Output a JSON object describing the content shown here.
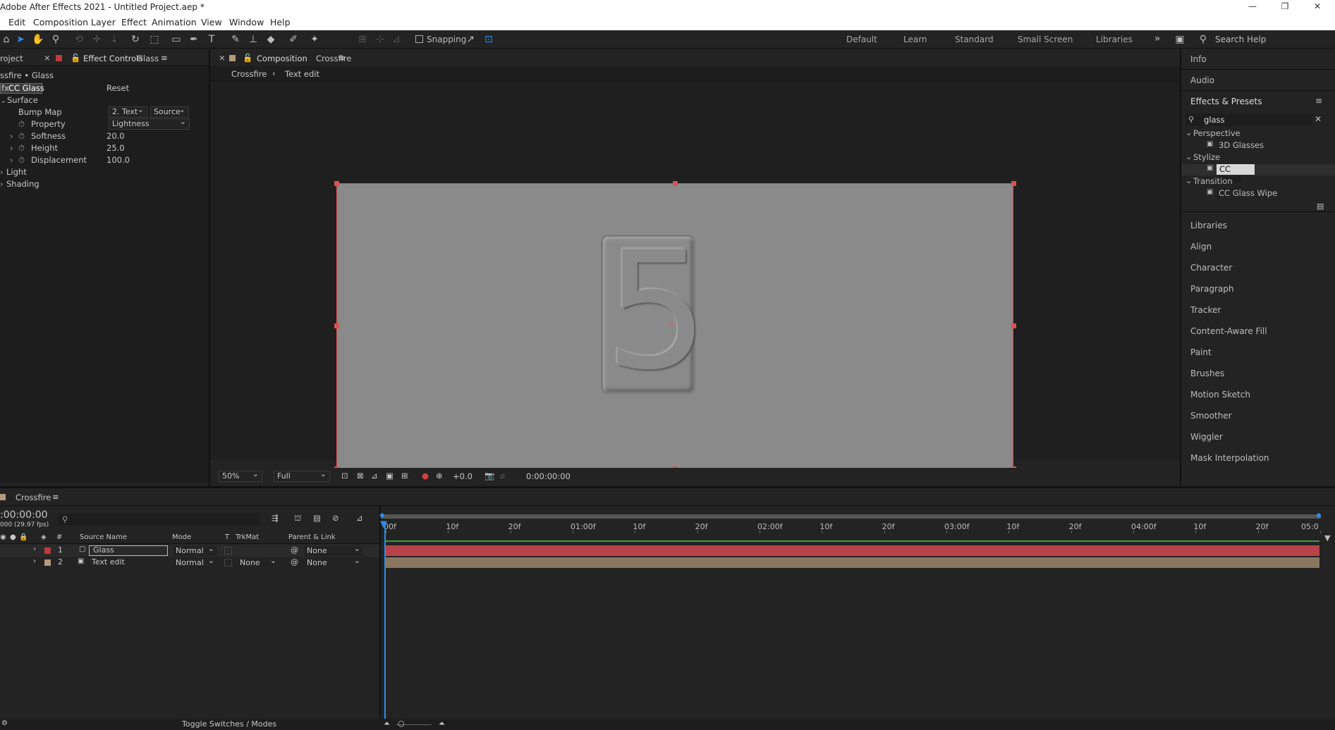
{
  "window": {
    "title": "Adobe After Effects 2021 - Untitled Project.aep *"
  },
  "menu": [
    "Edit",
    "Composition",
    "Layer",
    "Effect",
    "Animation",
    "View",
    "Window",
    "Help"
  ],
  "toolbar": {
    "snapping_label": "Snapping",
    "search_placeholder": "Search Help"
  },
  "workspaces": [
    "Default",
    "Learn",
    "Standard",
    "Small Screen",
    "Libraries"
  ],
  "effect_controls": {
    "project_tab": "roject",
    "tab_label": "Effect Controls",
    "tab_layer": "Glass",
    "breadcrumb": "ssfire • Glass",
    "effect_name": "CC Glass",
    "reset_label": "Reset",
    "surface_label": "Surface",
    "bump_map_label": "Bump Map",
    "bump_map_value": "2. Text",
    "bump_map_source": "Source",
    "property_label": "Property",
    "property_value": "Lightness",
    "softness_label": "Softness",
    "softness_value": "20.0",
    "height_label": "Height",
    "height_value": "25.0",
    "displacement_label": "Displacement",
    "displacement_value": "100.0",
    "light_label": "Light",
    "shading_label": "Shading"
  },
  "composition": {
    "tab_label": "Composition",
    "tab_name": "Crossfire",
    "crumb_active": "Crossfire",
    "crumb_next": "Text edit",
    "zoom": "50%",
    "resolution": "Full",
    "exposure": "+0.0",
    "timecode": "0:00:00:00",
    "glyph": "5"
  },
  "right_panel": {
    "info": "Info",
    "audio": "Audio",
    "effects_presets": "Effects & Presets",
    "search_value": "glass",
    "tree": [
      {
        "group": "Perspective",
        "items": [
          "3D Glasses"
        ]
      },
      {
        "group": "Stylize",
        "items": [
          "CC Glass"
        ]
      },
      {
        "group": "Transition",
        "items": [
          "CC Glass Wipe"
        ]
      }
    ],
    "panels": [
      "Libraries",
      "Align",
      "Character",
      "Paragraph",
      "Tracker",
      "Content-Aware Fill",
      "Paint",
      "Brushes",
      "Motion Sketch",
      "Smoother",
      "Wiggler",
      "Mask Interpolation"
    ]
  },
  "timeline": {
    "tab_name": "Crossfire",
    "timecode": ":00:00:00",
    "fps": "000 (29.97 fps)",
    "columns": {
      "num": "#",
      "source": "Source Name",
      "mode": "Mode",
      "t": "T",
      "trkmat": "TrkMat",
      "parent": "Parent & Link"
    },
    "layers": [
      {
        "num": "1",
        "name": "Glass",
        "mode": "Normal",
        "trkmat": "",
        "parent": "None",
        "color": "#c0393d"
      },
      {
        "num": "2",
        "name": "Text edit",
        "mode": "Normal",
        "trkmat": "None",
        "parent": "None",
        "color": "#b39a7c"
      }
    ],
    "ruler": [
      "00f",
      "10f",
      "20f",
      "01:00f",
      "10f",
      "20f",
      "02:00f",
      "10f",
      "20f",
      "03:00f",
      "10f",
      "20f",
      "04:00f",
      "10f",
      "20f",
      "05:0"
    ],
    "toggle_label": "Toggle Switches / Modes"
  },
  "colors": {
    "accent": "#2d8ceb",
    "layer1": "#c0393d",
    "layer2": "#b39a7c",
    "work_area": "#3a9d3a"
  }
}
